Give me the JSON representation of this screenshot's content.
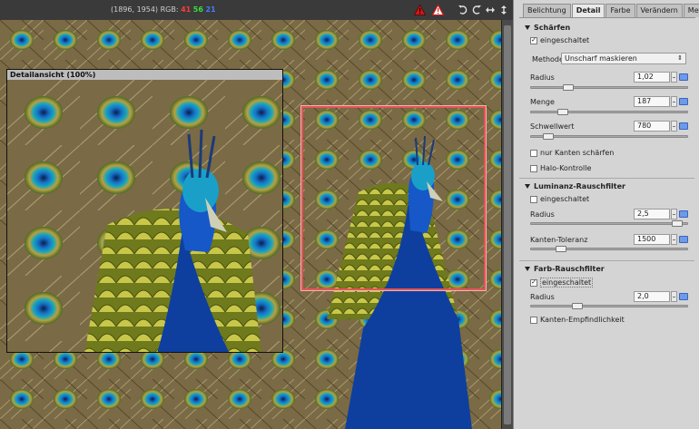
{
  "toolbar": {
    "coords": "(1896, 1954) RGB:",
    "rgb_r": "41",
    "rgb_g": "56",
    "rgb_b": "21"
  },
  "viewer": {
    "detail_title": "Detailansicht (100%)"
  },
  "tabs": [
    "Belichtung",
    "Detail",
    "Farbe",
    "Verändern",
    "Metadata"
  ],
  "active_tab": "Detail",
  "sharpen": {
    "title": "Schärfen",
    "enabled_label": "eingeschaltet",
    "enabled": true,
    "method_label": "Methode:",
    "method_value": "Unscharf maskieren",
    "radius_label": "Radius",
    "radius_value": "1,02",
    "radius_fraction": 0.22,
    "amount_label": "Menge",
    "amount_value": "187",
    "amount_fraction": 0.18,
    "threshold_label": "Schwellwert",
    "threshold_value": "780",
    "threshold_fraction": 0.08,
    "edges_only_label": "nur Kanten schärfen",
    "edges_only": false,
    "halo_label": "Halo-Kontrolle",
    "halo": false
  },
  "luminance": {
    "title": "Luminanz-Rauschfilter",
    "enabled_label": "eingeschaltet",
    "enabled": false,
    "radius_label": "Radius",
    "radius_value": "2,5",
    "radius_fraction": 0.97,
    "tolerance_label": "Kanten-Toleranz",
    "tolerance_value": "1500",
    "tolerance_fraction": 0.17
  },
  "color": {
    "title": "Farb-Rauschfilter",
    "enabled_label": "eingeschaltet",
    "enabled": true,
    "radius_label": "Radius",
    "radius_value": "2,0",
    "radius_fraction": 0.28,
    "sensitivity_label": "Kanten-Empfindlichkeit",
    "sensitivity": false
  },
  "icons": [
    "warning-red-icon",
    "warning-outline-icon",
    "rotate-left-icon",
    "rotate-right-icon",
    "flip-horizontal-icon",
    "flip-vertical-icon"
  ]
}
